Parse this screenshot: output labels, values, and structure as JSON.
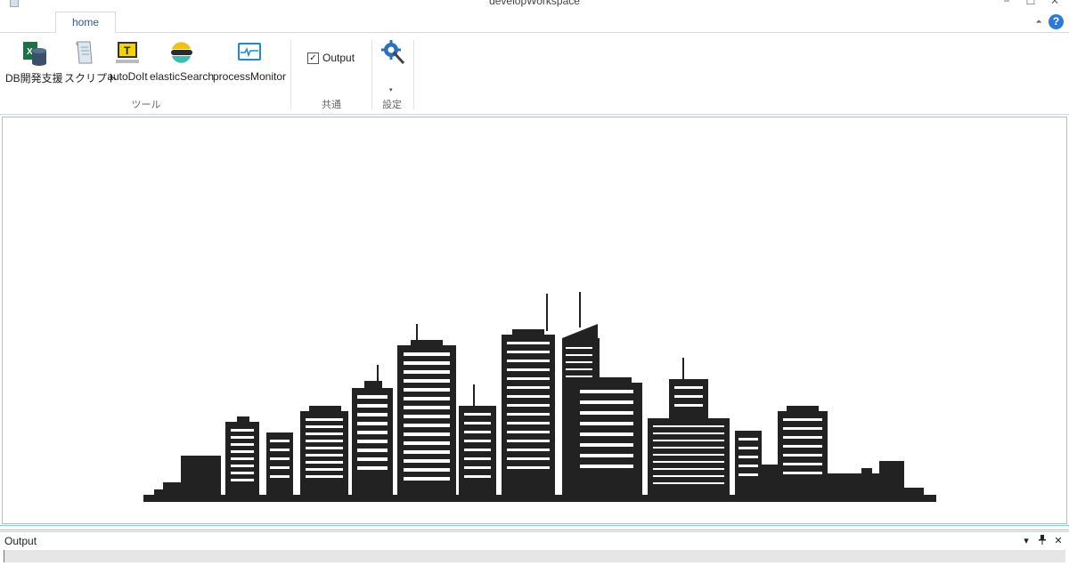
{
  "window": {
    "title": "developWorkspace",
    "minimize_glyph": "−",
    "maximize_glyph": "☐",
    "close_glyph": "✕"
  },
  "tabs": [
    {
      "label": "home",
      "selected": true
    }
  ],
  "help": {
    "glyph": "?",
    "collapse_glyph": "⏶"
  },
  "ribbon": {
    "groups": [
      {
        "label": "ツール",
        "buttons": [
          {
            "label": "DB開発支援",
            "icon": "excel-database-icon"
          },
          {
            "label": "スクリプト",
            "icon": "script-scroll-icon"
          },
          {
            "label": "autoDoIt",
            "icon": "autodoit-monitor-icon"
          },
          {
            "label": "elasticSearch",
            "icon": "elasticsearch-logo-icon"
          },
          {
            "label": "processMonitor",
            "icon": "process-monitor-icon"
          }
        ]
      },
      {
        "label": "共通",
        "checkbox": {
          "label": "Output",
          "checked": true,
          "check_glyph": "✓"
        }
      },
      {
        "label": "設定",
        "buttons": [
          {
            "label": "",
            "icon": "gear-wrench-icon",
            "dropdown_glyph": "▾"
          }
        ]
      }
    ]
  },
  "main_view": {
    "image": "city-skyline-silhouette",
    "silhouette_color": "#222222"
  },
  "output_panel": {
    "title": "Output",
    "dropdown_glyph": "▾",
    "pin_glyph": "📌",
    "close_glyph": "✕",
    "content": ""
  },
  "colors": {
    "accent": "#2b579a",
    "help_blue": "#2b7bd5",
    "splitter": "#7fd0e6"
  }
}
